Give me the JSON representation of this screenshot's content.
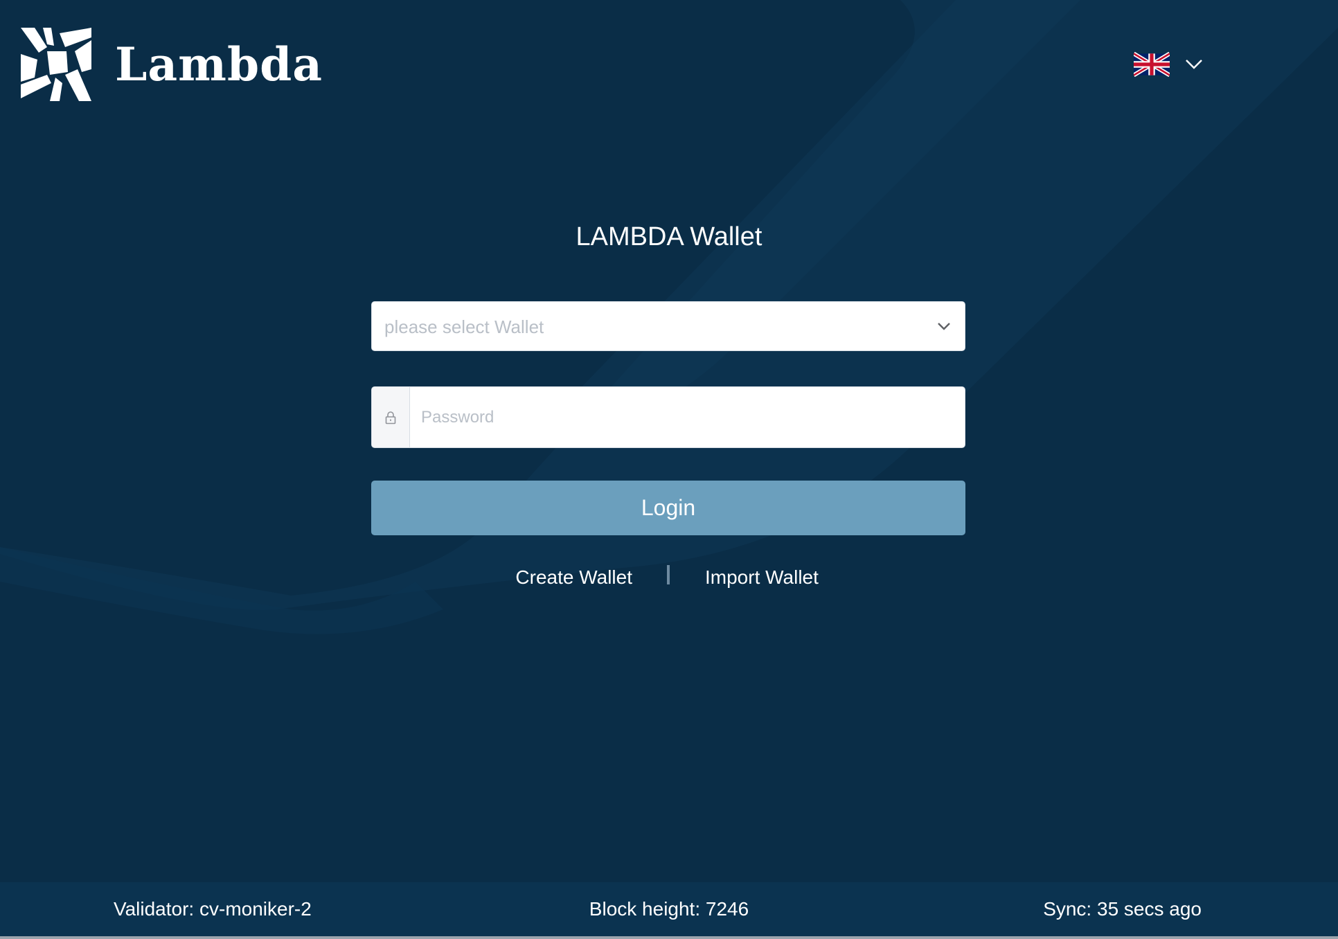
{
  "header": {
    "brand": "Lambda",
    "language_icon": "uk-flag-icon"
  },
  "login": {
    "title": "LAMBDA Wallet",
    "wallet_select_placeholder": "please select Wallet",
    "password_placeholder": "Password",
    "login_label": "Login",
    "create_wallet_label": "Create Wallet",
    "import_wallet_label": "Import Wallet"
  },
  "footer": {
    "validator": "Validator: cv-moniker-2",
    "block_height": "Block height: 7246",
    "sync": "Sync: 35 secs ago"
  },
  "colors": {
    "background": "#0a2d47",
    "login_button": "#6b9fbd",
    "footer": "#0b3350"
  }
}
